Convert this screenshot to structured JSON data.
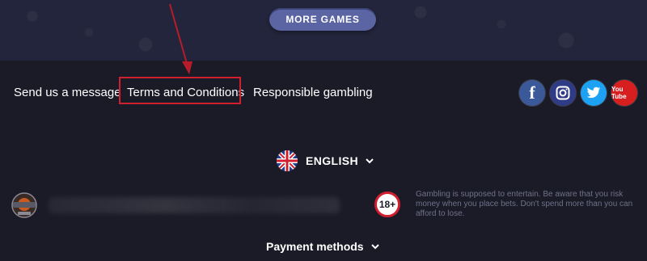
{
  "header": {
    "more_games_label": "MORE GAMES"
  },
  "nav": {
    "links": [
      {
        "label": "Send us a message"
      },
      {
        "label": "Terms and Conditions"
      },
      {
        "label": "Responsible gambling"
      }
    ]
  },
  "social": [
    {
      "name": "facebook",
      "glyph": "f",
      "color": "#3b5998"
    },
    {
      "name": "instagram",
      "glyph": "◎",
      "color": "#2f3b86"
    },
    {
      "name": "twitter",
      "glyph": "t",
      "color": "#1da1f2"
    },
    {
      "name": "youtube",
      "glyph": "You Tube",
      "color": "#d81f1f"
    }
  ],
  "language": {
    "label": "ENGLISH",
    "flag_icon": "uk-flag-icon"
  },
  "age": {
    "label": "18+"
  },
  "disclaimer": "Gambling is supposed to entertain. Be aware that you risk money when you place bets. Don't spend more than you can afford to lose.",
  "payment": {
    "label": "Payment methods"
  },
  "colors": {
    "highlight": "#d01f2f",
    "background": "#1b1b28",
    "button": "#5b65a3"
  }
}
